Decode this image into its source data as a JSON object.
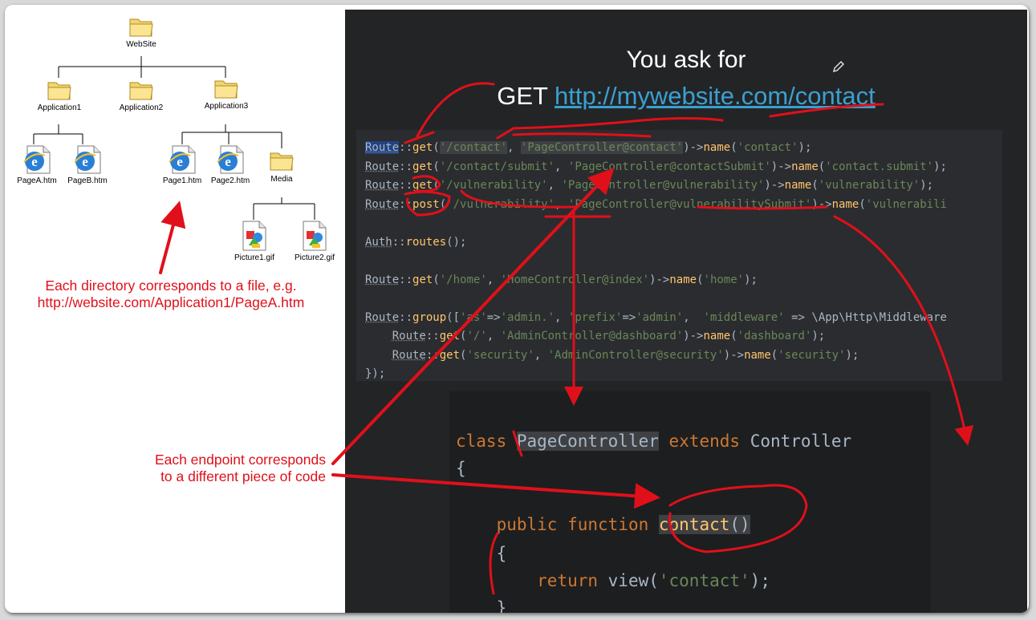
{
  "tree": {
    "root": "WebSite",
    "applications": [
      "Application1",
      "Application2",
      "Application3"
    ],
    "app1_files": [
      "PageA.htm",
      "PageB.htm"
    ],
    "app3_children": [
      "Page1.htm",
      "Page2.htm",
      "Media"
    ],
    "media_files": [
      "Picture1.gif",
      "Picture2.gif"
    ]
  },
  "annotations": {
    "directory_note": [
      "Each directory corresponds to a file, e.g.",
      "http://website.com/Application1/PageA.htm"
    ],
    "endpoint_note": [
      "Each endpoint corresponds",
      "to a different piece of code"
    ]
  },
  "slide": {
    "title": "You ask for",
    "method": "GET",
    "url": "http://mywebsite.com/contact"
  },
  "routes_code": [
    "Route::get('/contact', 'PageController@contact')->name('contact');",
    "Route::get('/contact/submit', 'PageController@contactSubmit')->name('contact.submit');",
    "Route::get('/vulnerability', 'PageController@vulnerability')->name('vulnerability');",
    "Route::post('/vulnerability', 'PageController@vulnerabilitySubmit')->name('vulnerabili",
    "Auth::routes();",
    "Route::get('/home', 'HomeController@index')->name('home');",
    "Route::group(['as'=>'admin.', 'prefix'=>'admin',  'middleware' => \\App\\Http\\Middleware",
    "    Route::get('/', 'AdminController@dashboard')->name('dashboard');",
    "    Route::get('security', 'AdminController@security')->name('security');",
    "});"
  ],
  "controller_code": [
    "class PageController extends Controller",
    "{",
    "    public function contact()",
    "    {",
    "        return view('contact');",
    "    }"
  ],
  "colors": {
    "annotation_red": "#e0101a",
    "slide_bg": "#232426",
    "code_bg": "#2b2c2f",
    "keyword": "#cc7832",
    "string": "#6a8759",
    "function": "#ffc66d",
    "link": "#3aa0d0"
  },
  "icons": {
    "folder": "folder-icon",
    "html_page": "ie-page-icon",
    "image_file": "gif-file-icon",
    "edit": "pencil-icon"
  }
}
